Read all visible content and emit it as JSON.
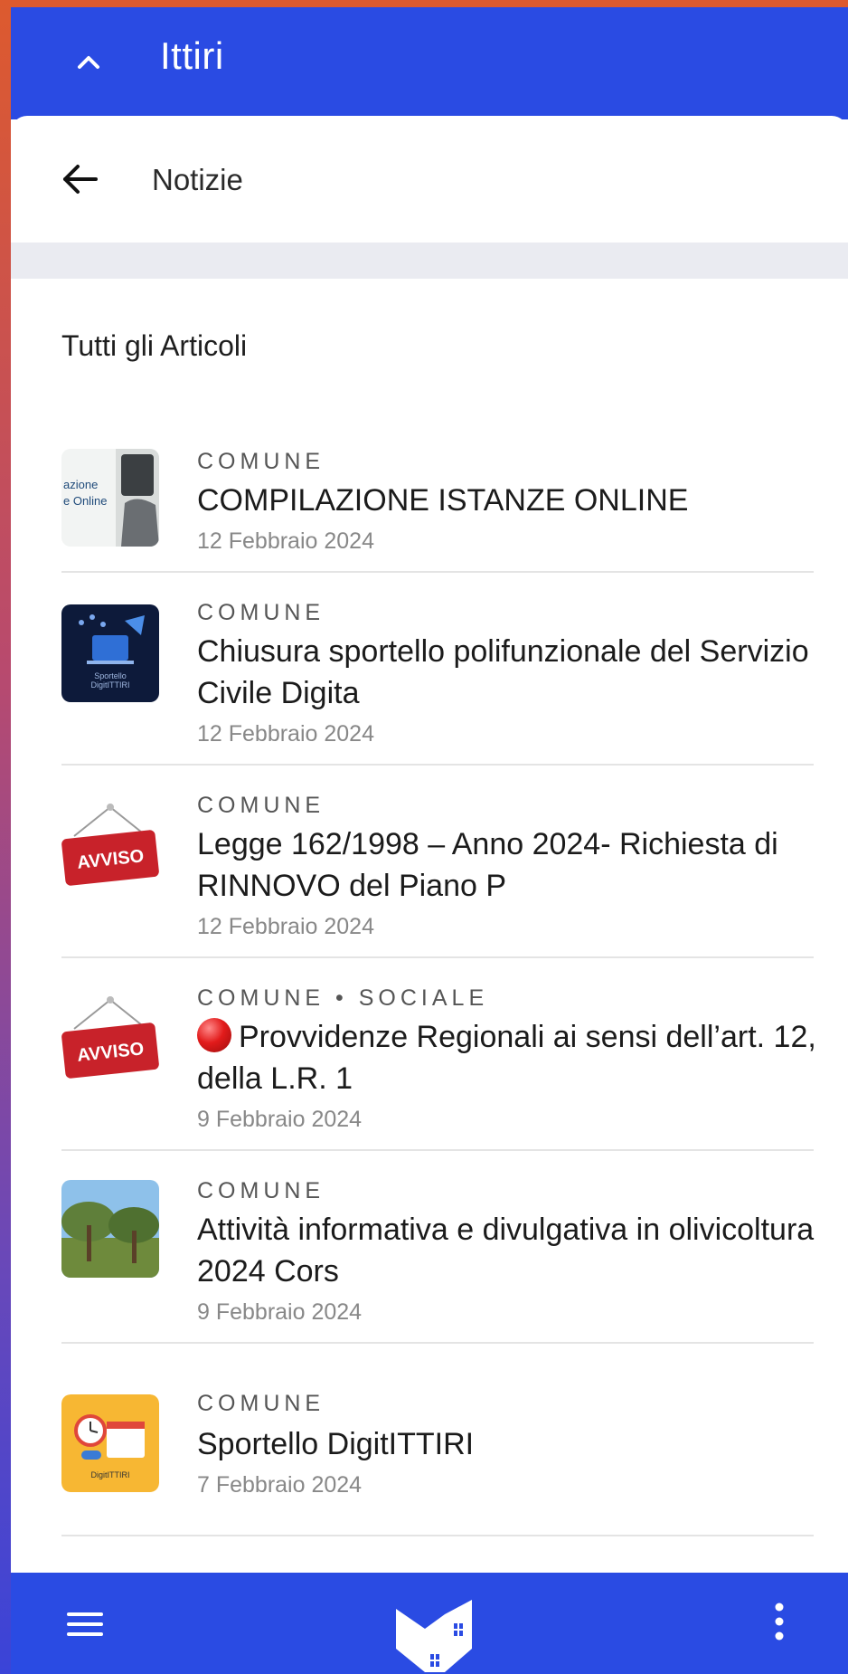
{
  "app": {
    "title": "Ittiri"
  },
  "header": {
    "title": "Notizie"
  },
  "section": {
    "title": "Tutti gli Articoli"
  },
  "articles": [
    {
      "category": "COMUNE",
      "title": "COMPILAZIONE ISTANZE ONLINE",
      "date": "12 Febbraio 2024",
      "thumb_text": "azione\ne Online"
    },
    {
      "category": "COMUNE",
      "title": "Chiusura sportello polifunzionale del Servizio Civile Digita",
      "date": "12 Febbraio 2024",
      "thumb_text": "Sportello DigitITTIRI"
    },
    {
      "category": "COMUNE",
      "title": "Legge 162/1998 – Anno 2024- Richiesta di RINNOVO del Piano P",
      "date": "12 Febbraio 2024",
      "thumb_text": "AVVISO"
    },
    {
      "category": "COMUNE • SOCIALE",
      "title": "Provvidenze Regionali ai sensi dell’art. 12, della L.R. 1",
      "date": "9 Febbraio 2024",
      "thumb_text": "AVVISO"
    },
    {
      "category": "COMUNE",
      "title": "Attività informativa e divulgativa in olivicoltura 2024 Cors",
      "date": "9 Febbraio 2024",
      "thumb_text": ""
    },
    {
      "category": "COMUNE",
      "title": "Sportello DigitITTIRI",
      "date": "7 Febbraio 2024",
      "thumb_text": "DigitITTIRI"
    }
  ],
  "colors": {
    "primary": "#2a4be3",
    "accent_red": "#c8222a",
    "divider": "#e4e4e4"
  },
  "icons": {
    "collapse": "chevron-up-icon",
    "back": "arrow-left-icon",
    "menu": "hamburger-menu-icon",
    "logo": "town-logo-icon",
    "more": "more-vert-icon"
  }
}
